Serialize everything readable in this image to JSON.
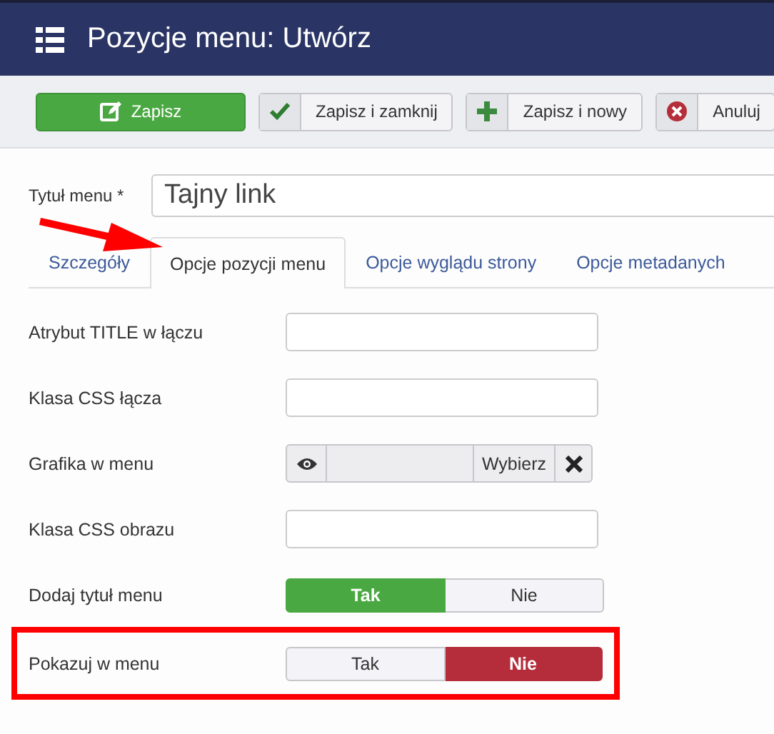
{
  "header": {
    "title": "Pozycje menu: Utwórz"
  },
  "toolbar": [
    {
      "label": "Zapisz",
      "kind": "primary"
    },
    {
      "label": "Zapisz i zamknij",
      "kind": "check"
    },
    {
      "label": "Zapisz i nowy",
      "kind": "plus"
    },
    {
      "label": "Anuluj",
      "kind": "cancel"
    }
  ],
  "title_field": {
    "label": "Tytuł menu *",
    "value": "Tajny link"
  },
  "tabs": [
    {
      "label": "Szczegóły",
      "selected": false
    },
    {
      "label": "Opcje pozycji menu",
      "selected": true
    },
    {
      "label": "Opcje wyglądu strony",
      "selected": false
    },
    {
      "label": "Opcje metadanych",
      "selected": false
    }
  ],
  "fields": [
    {
      "label": "Atrybut TITLE w łączu",
      "kind": "text",
      "highlighted": false
    },
    {
      "label": "Klasa CSS łącza",
      "kind": "text",
      "highlighted": false
    },
    {
      "label": "Grafika w menu",
      "kind": "media",
      "button": "Wybierz",
      "highlighted": false
    },
    {
      "label": "Klasa CSS obrazu",
      "kind": "text",
      "highlighted": false
    },
    {
      "label": "Dodaj tytuł menu",
      "kind": "toggle",
      "highlighted": false,
      "options": [
        {
          "label": "Tak",
          "kind": "yes",
          "selected": true
        },
        {
          "label": "Nie",
          "kind": "no",
          "selected": false
        }
      ]
    },
    {
      "label": "Pokazuj w menu",
      "kind": "toggle",
      "highlighted": true,
      "options": [
        {
          "label": "Tak",
          "kind": "yes",
          "selected": false
        },
        {
          "label": "Nie",
          "kind": "no",
          "selected": true
        }
      ]
    }
  ],
  "annotation": {
    "kind": "arrow"
  }
}
